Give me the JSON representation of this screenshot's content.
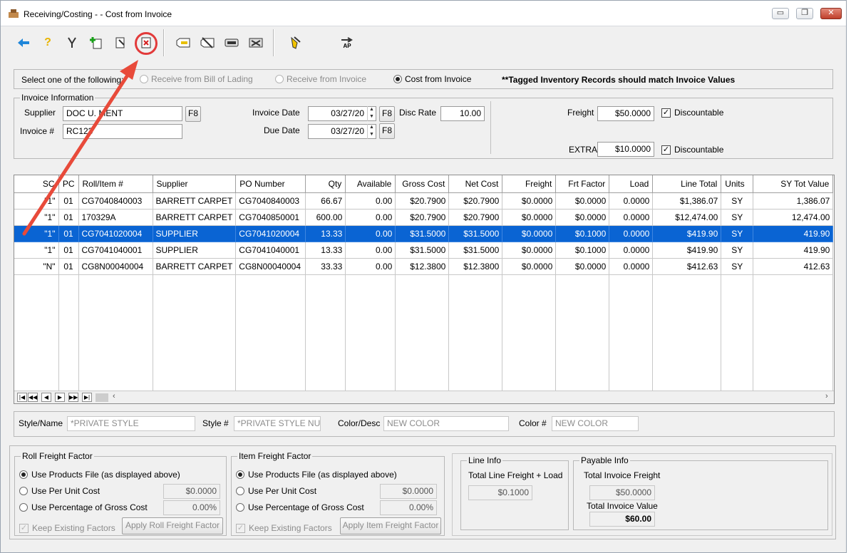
{
  "window": {
    "title": "Receiving/Costing - - Cost from Invoice",
    "min_label": "▭",
    "max_label": "❐",
    "close_label": "✕"
  },
  "select_bar": {
    "prompt": "Select one of the following:",
    "options": [
      {
        "label": "Receive from Bill of Lading",
        "checked": false,
        "disabled": true
      },
      {
        "label": "Receive from Invoice",
        "checked": false,
        "disabled": true
      },
      {
        "label": "Cost from Invoice",
        "checked": true,
        "disabled": false
      }
    ],
    "note": "**Tagged Inventory Records should match Invoice Values"
  },
  "invoice": {
    "legend": "Invoice Information",
    "supplier_label": "Supplier",
    "supplier_value": "DOC U. MENT",
    "supplier_f8": "F8",
    "invoice_no_label": "Invoice #",
    "invoice_no_value": "RC123",
    "invoice_date_label": "Invoice Date",
    "invoice_date_value": "03/27/20",
    "invoice_date_f8": "F8",
    "due_date_label": "Due Date",
    "due_date_value": "03/27/20",
    "due_date_f8": "F8",
    "disc_rate_label": "Disc Rate",
    "disc_rate_value": "10.00",
    "freight_label": "Freight",
    "freight_value": "$50.0000",
    "freight_discountable": "Discountable",
    "extra_label": "EXTRA",
    "extra_value": "$10.0000",
    "extra_discountable": "Discountable"
  },
  "grid": {
    "columns": [
      "SC",
      "PC",
      "Roll/Item #",
      "Supplier",
      "PO Number",
      "Qty",
      "Available",
      "Gross Cost",
      "Net Cost",
      "Freight",
      "Frt Factor",
      "Load",
      "Line Total",
      "Units",
      "SY Tot Value"
    ],
    "rows": [
      {
        "sc": "\"1\"",
        "pc": "01",
        "roll": "CG7040840003",
        "supplier": "BARRETT CARPET",
        "po": "CG7040840003",
        "qty": "66.67",
        "available": "0.00",
        "gross": "$20.7900",
        "net": "$20.7900",
        "freight": "$0.0000",
        "frt_factor": "$0.0000",
        "load": "0.0000",
        "line_total": "$1,386.07",
        "units": "SY",
        "sy_tot": "1,386.07",
        "selected": false
      },
      {
        "sc": "\"1\"",
        "pc": "01",
        "roll": "170329A",
        "supplier": "BARRETT CARPET",
        "po": "CG7040850001",
        "qty": "600.00",
        "available": "0.00",
        "gross": "$20.7900",
        "net": "$20.7900",
        "freight": "$0.0000",
        "frt_factor": "$0.0000",
        "load": "0.0000",
        "line_total": "$12,474.00",
        "units": "SY",
        "sy_tot": "12,474.00",
        "selected": false
      },
      {
        "sc": "\"1\"",
        "pc": "01",
        "roll": "CG7041020004",
        "supplier": "SUPPLIER",
        "po": "CG7041020004",
        "qty": "13.33",
        "available": "0.00",
        "gross": "$31.5000",
        "net": "$31.5000",
        "freight": "$0.0000",
        "frt_factor": "$0.1000",
        "load": "0.0000",
        "line_total": "$419.90",
        "units": "SY",
        "sy_tot": "419.90",
        "selected": true
      },
      {
        "sc": "\"1\"",
        "pc": "01",
        "roll": "CG7041040001",
        "supplier": "SUPPLIER",
        "po": "CG7041040001",
        "qty": "13.33",
        "available": "0.00",
        "gross": "$31.5000",
        "net": "$31.5000",
        "freight": "$0.0000",
        "frt_factor": "$0.1000",
        "load": "0.0000",
        "line_total": "$419.90",
        "units": "SY",
        "sy_tot": "419.90",
        "selected": false
      },
      {
        "sc": "\"N\"",
        "pc": "01",
        "roll": "CG8N00040004",
        "supplier": "BARRETT CARPET",
        "po": "CG8N00040004",
        "qty": "33.33",
        "available": "0.00",
        "gross": "$12.3800",
        "net": "$12.3800",
        "freight": "$0.0000",
        "frt_factor": "$0.0000",
        "load": "0.0000",
        "line_total": "$412.63",
        "units": "SY",
        "sy_tot": "412.63",
        "selected": false
      }
    ],
    "nav": [
      "|◀",
      "◀◀",
      "◀",
      "▶",
      "▶▶",
      "▶|"
    ]
  },
  "style_info": {
    "style_name_label": "Style/Name",
    "style_name_ph": "*PRIVATE STYLE",
    "style_no_label": "Style #",
    "style_no_ph": "*PRIVATE  STYLE NUM",
    "color_desc_label": "Color/Desc",
    "color_desc_ph": "NEW COLOR",
    "color_no_label": "Color #",
    "color_no_ph": "NEW COLOR"
  },
  "roll_freight": {
    "legend": "Roll Freight Factor",
    "opt_products": "Use Products File (as displayed above)",
    "opt_unit": "Use Per Unit Cost",
    "unit_value": "$0.0000",
    "opt_pct": "Use Percentage of Gross Cost",
    "pct_value": "0.00%",
    "keep": "Keep Existing Factors",
    "apply": "Apply Roll Freight Factor"
  },
  "item_freight": {
    "legend": "Item Freight Factor",
    "opt_products": "Use Products File (as displayed above)",
    "opt_unit": "Use Per Unit Cost",
    "unit_value": "$0.0000",
    "opt_pct": "Use Percentage of Gross Cost",
    "pct_value": "0.00%",
    "keep": "Keep Existing Factors",
    "apply": "Apply Item Freight Factor"
  },
  "line_info": {
    "legend": "Line Info",
    "label": "Total Line Freight + Load",
    "value": "$0.1000"
  },
  "payable_info": {
    "legend": "Payable Info",
    "freight_label": "Total Invoice Freight",
    "freight_value": "$50.0000",
    "value_label": "Total Invoice Value",
    "value_value": "$60.00"
  },
  "toolbar": {
    "icons": [
      "back-arrow-icon",
      "help-icon",
      "tools-icon",
      "add-record-icon",
      "edit-record-icon",
      "delete-record-icon",
      "tag-icon",
      "untag-icon",
      "print-icon",
      "export-icon",
      "hand-pointer-icon",
      "ap-transfer-icon"
    ],
    "ap_label": "AP"
  },
  "colors": {
    "accent": "#0a64d3",
    "highlight": "#e23a3a"
  }
}
